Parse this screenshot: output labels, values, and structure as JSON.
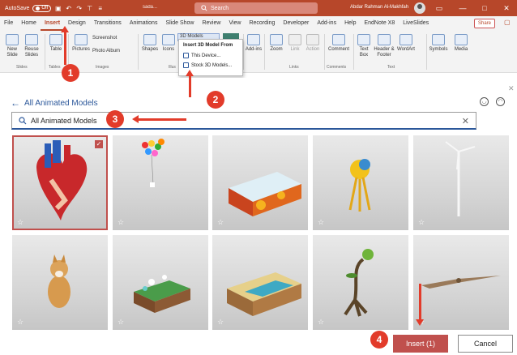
{
  "titlebar": {
    "autosave_label": "AutoSave",
    "autosave_state": "Off",
    "doc_name": "sada...",
    "search_placeholder": "Search",
    "user_name": "Abdar Rahman Al-Makhfah",
    "minimize": "—",
    "restore": "□",
    "close": "✕"
  },
  "menu": {
    "tabs": [
      "File",
      "Home",
      "Insert",
      "Design",
      "Transitions",
      "Animations",
      "Slide Show",
      "Review",
      "View",
      "Recording",
      "Developer",
      "Add-ins",
      "Help",
      "EndNote X8",
      "LiveSlides"
    ],
    "active_tab": "Insert",
    "share_label": "Share"
  },
  "ribbon": {
    "new_slide": "New Slide",
    "reuse_slides": "Reuse Slides",
    "table": "Table",
    "pictures": "Pictures",
    "screenshot": "Screenshot",
    "photo_album": "Photo Album",
    "shapes": "Shapes",
    "icons": "Icons",
    "three_d_models": "3D Models",
    "add_ins": "Add-ins",
    "zoom": "Zoom",
    "link": "Link",
    "action": "Action",
    "comment": "Comment",
    "text_box": "Text Box",
    "header_footer": "Header & Footer",
    "wordart": "WordArt",
    "symbols": "Symbols",
    "media": "Media",
    "groups": {
      "slides": "Slides",
      "tables": "Tables",
      "images": "Images",
      "illus": "Illus",
      "links": "Links",
      "comments": "Comments",
      "text": "Text"
    }
  },
  "dropdown": {
    "header": "Insert 3D Model From",
    "items": [
      "This Device...",
      "Stock 3D Models..."
    ]
  },
  "dialog": {
    "back_label": "All Animated Models",
    "search_value": "All Animated Models",
    "insert_button": "Insert (1)",
    "cancel_button": "Cancel",
    "tiles": [
      {
        "model": "animated heart",
        "selected": true
      },
      {
        "model": "balloons",
        "selected": false
      },
      {
        "model": "lava block",
        "selected": false
      },
      {
        "model": "yellow creature",
        "selected": false
      },
      {
        "model": "wind turbine",
        "selected": false
      },
      {
        "model": "shiba dog",
        "selected": false
      },
      {
        "model": "island scene",
        "selected": false
      },
      {
        "model": "beach terrain block",
        "selected": false
      },
      {
        "model": "plant creature",
        "selected": false
      },
      {
        "model": "pterodactyl",
        "selected": false
      }
    ]
  },
  "annotations": {
    "step1": "1",
    "step2": "2",
    "step3": "3",
    "step4": "4",
    "color": "#e23b2a"
  }
}
